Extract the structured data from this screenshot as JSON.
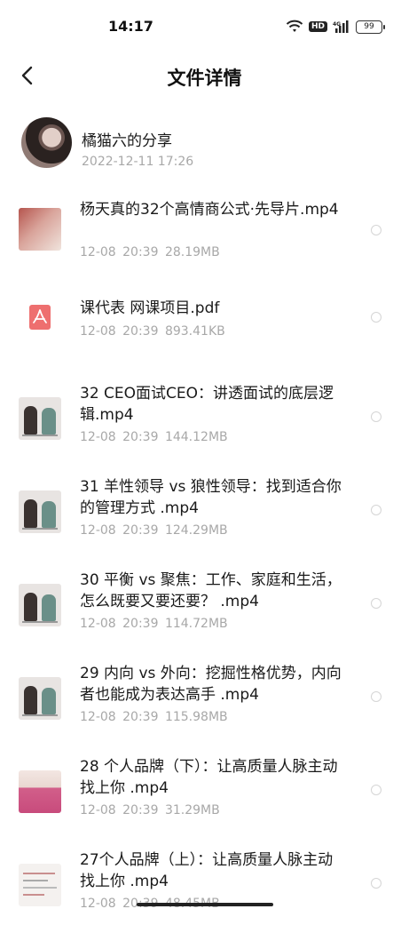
{
  "status_bar": {
    "time": "14:17",
    "hd": "HD",
    "network": "4G",
    "battery": "99",
    "icons": [
      "wifi-icon",
      "signal-icon",
      "battery-icon"
    ]
  },
  "header": {
    "title": "文件详情",
    "back_icon": "chevron-left-icon"
  },
  "sharer": {
    "name": "橘猫六的分享",
    "time": "2022-12-11  17:26"
  },
  "files": [
    {
      "name": "杨天真的32个高情商公式·先导片.mp4",
      "date": "12-08",
      "time": "20:39",
      "size": "28.19MB",
      "thumb": "video-thumbnail"
    },
    {
      "name": "课代表 网课项目.pdf",
      "date": "12-08",
      "time": "20:39",
      "size": "893.41KB",
      "thumb": "pdf-icon"
    },
    {
      "name": "32 CEO面试CEO：讲透面试的底层逻辑.mp4",
      "date": "12-08",
      "time": "20:39",
      "size": "144.12MB",
      "thumb": "video-thumbnail"
    },
    {
      "name": "31 羊性领导 vs 狼性领导：找到适合你的管理方式 .mp4",
      "date": "12-08",
      "time": "20:39",
      "size": "124.29MB",
      "thumb": "video-thumbnail"
    },
    {
      "name": "30 平衡 vs 聚焦：工作、家庭和生活，怎么既要又要还要？ .mp4",
      "date": "12-08",
      "time": "20:39",
      "size": "114.72MB",
      "thumb": "video-thumbnail"
    },
    {
      "name": "29  内向 vs 外向：挖掘性格优势，内向者也能成为表达高手 .mp4",
      "date": "12-08",
      "time": "20:39",
      "size": "115.98MB",
      "thumb": "video-thumbnail"
    },
    {
      "name": "28 个人品牌（下）：让高质量人脉主动找上你 .mp4",
      "date": "12-08",
      "time": "20:39",
      "size": "31.29MB",
      "thumb": "video-thumbnail"
    },
    {
      "name": "27个人品牌（上）：让高质量人脉主动找上你 .mp4",
      "date": "12-08",
      "time": "20:39",
      "size": "48.45MB",
      "thumb": "video-thumbnail"
    }
  ],
  "colors": {
    "pdf_accent": "#ee6f6f",
    "meta_text": "#a8a8a8",
    "radio_border": "#d5d5d5"
  }
}
